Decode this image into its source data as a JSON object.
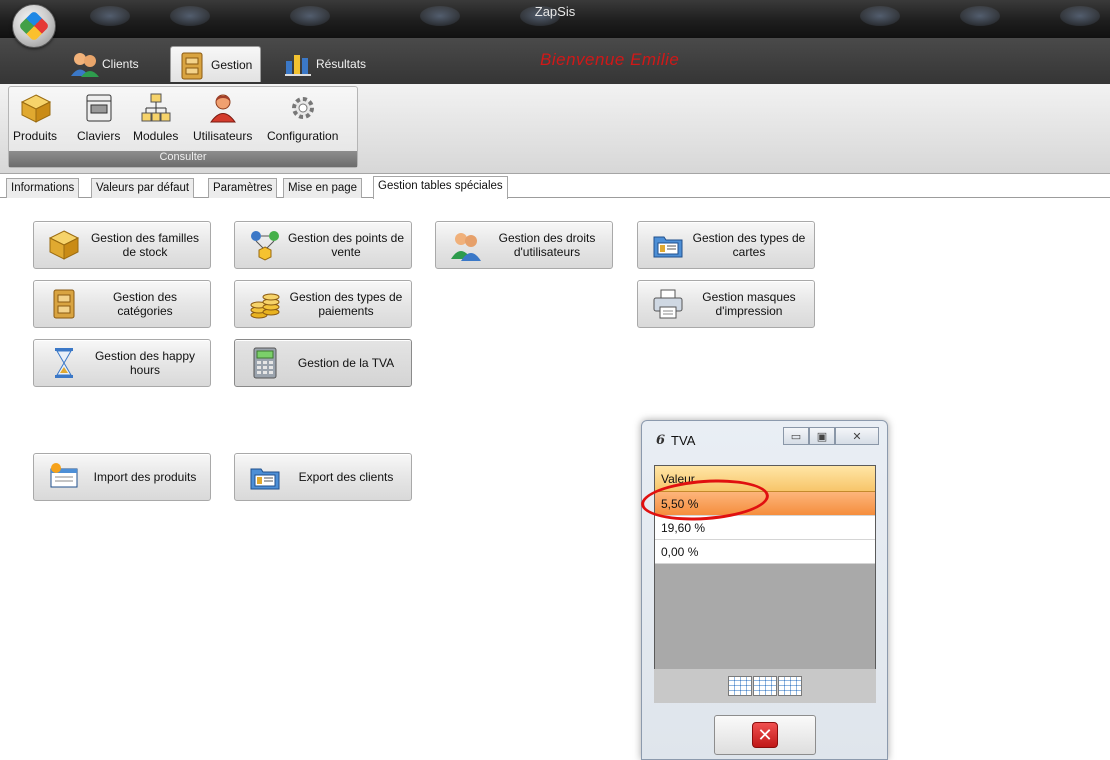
{
  "app": {
    "title": "ZapSis",
    "welcome": "Bienvenue Emilie"
  },
  "menu": {
    "tabs": [
      {
        "label": "Clients",
        "icon": "clients-icon"
      },
      {
        "label": "Gestion",
        "icon": "gestion-icon"
      },
      {
        "label": "Résultats",
        "icon": "resultats-icon"
      }
    ],
    "active_tab": "Gestion"
  },
  "ribbon": {
    "group_label": "Consulter",
    "buttons": [
      {
        "label": "Produits",
        "icon": "box-icon"
      },
      {
        "label": "Claviers",
        "icon": "keyboard-icon"
      },
      {
        "label": "Modules",
        "icon": "modules-icon"
      },
      {
        "label": "Utilisateurs",
        "icon": "user-icon"
      },
      {
        "label": "Configuration",
        "icon": "gear-icon"
      }
    ]
  },
  "subtabs": [
    "Informations",
    "Valeurs par défaut",
    "Paramètres",
    "Mise en page",
    "Gestion tables spéciales"
  ],
  "active_subtab": "Gestion tables spéciales",
  "management": {
    "familles": "Gestion des familles de stock",
    "points_vente": "Gestion des points de vente",
    "droits": "Gestion des droits d'utilisateurs",
    "types_cartes": "Gestion des types de cartes",
    "categories": "Gestion des catégories",
    "types_paiements": "Gestion des types de paiements",
    "masques": "Gestion masques d'impression",
    "happy_hours": "Gestion des happy hours",
    "tva": "Gestion de la TVA",
    "import_produits": "Import des produits",
    "export_clients": "Export des clients"
  },
  "tva_dialog": {
    "title": "TVA",
    "column_header": "Valeur",
    "rows": [
      "5,50 %",
      "19,60 %",
      "0,00 %"
    ],
    "selected_row": "5,50 %",
    "highlight_color": "#e01010"
  }
}
